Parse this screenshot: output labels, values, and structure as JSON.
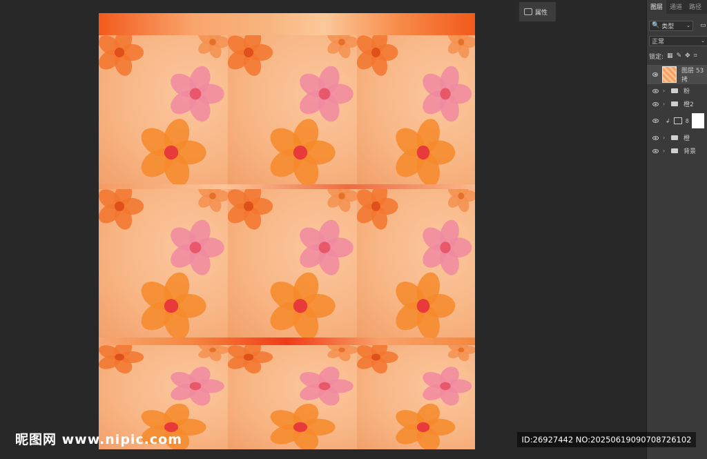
{
  "properties_button": {
    "label": "属性",
    "icon": "properties-icon"
  },
  "layers_panel": {
    "tabs": [
      "图层",
      "通道",
      "路径"
    ],
    "filter_select": "类型",
    "blend_mode": "正常",
    "lock_label": "锁定:",
    "layers": [
      {
        "name": "图层 53 拷",
        "type": "layer",
        "visible": true
      },
      {
        "name": "粉",
        "type": "group",
        "visible": true
      },
      {
        "name": "橙2",
        "type": "group",
        "visible": true
      },
      {
        "name": "",
        "type": "adjustment",
        "visible": true
      },
      {
        "name": "橙",
        "type": "group",
        "visible": true
      },
      {
        "name": "背景",
        "type": "group",
        "visible": true
      }
    ]
  },
  "watermark": {
    "text": "昵图网 www.nipic.com"
  },
  "id_bar": {
    "text": "ID:26927442 NO:20250619090708726102"
  }
}
